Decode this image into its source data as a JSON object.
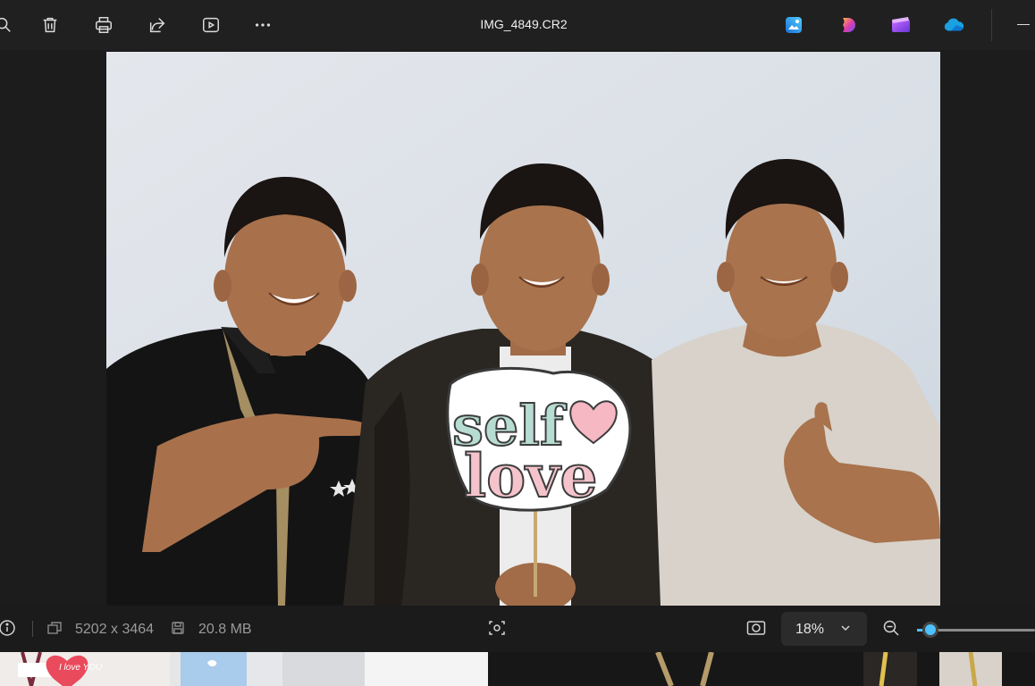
{
  "window": {
    "title": "IMG_4849.CR2"
  },
  "toolbar": {
    "icons": [
      "zoom-icon",
      "delete-icon",
      "print-icon",
      "share-icon",
      "slideshow-icon",
      "more-icon"
    ],
    "apps": [
      "photos-editor-icon",
      "clipchamp-icon",
      "designer-icon",
      "onedrive-icon"
    ]
  },
  "photo": {
    "sign_line1": "self",
    "sign_line2": "love"
  },
  "status": {
    "dimensions": "5202 x 3464",
    "file_size": "20.8 MB",
    "zoom": "18%",
    "zoom_fraction": 0.18
  },
  "filmstrip": {
    "thumb1_text": "I love YOU"
  },
  "colors": {
    "accent": "#4cc2ff",
    "toolbar_bg": "#202020",
    "status_bg": "#1b1b1b"
  }
}
